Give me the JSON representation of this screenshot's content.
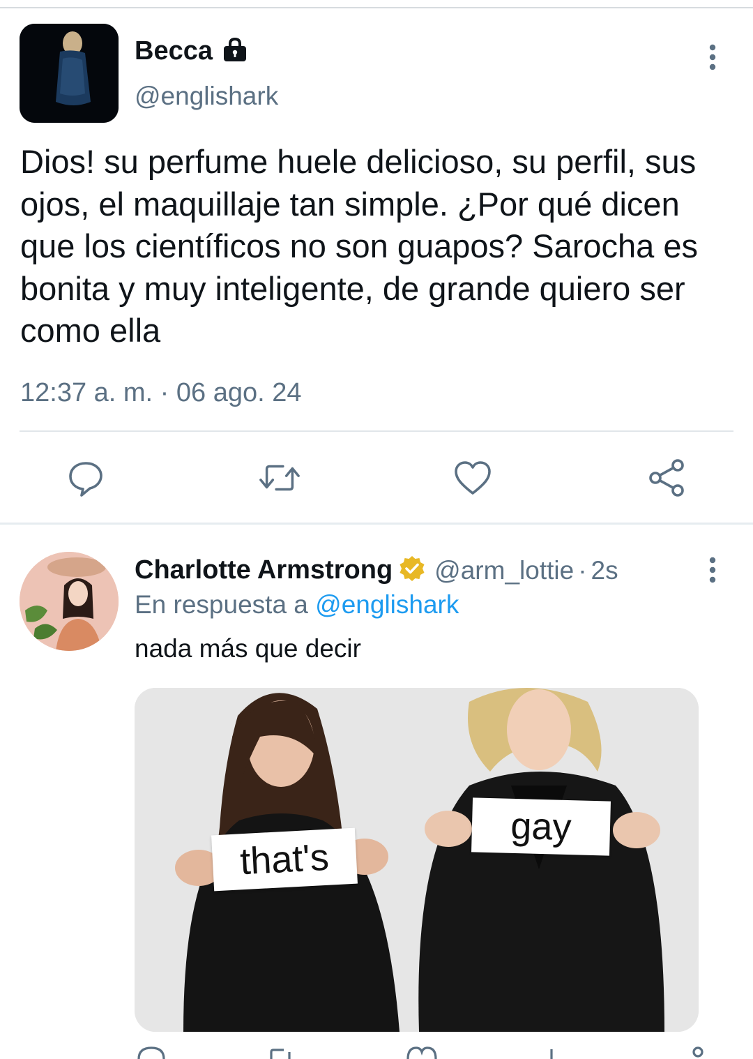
{
  "tweet": {
    "author_name": "Becca",
    "author_handle": "@englishark",
    "text": "Dios! su perfume huele delicioso, su perfil, sus ojos, el maquillaje tan simple. ¿Por qué dicen que los científicos no son guapos? Sarocha es bonita y muy inteligente, de grande quiero ser como ella",
    "timestamp": "12:37 a. m. · 06 ago. 24",
    "icons": {
      "protected": "lock-icon",
      "more": "more-vertical-icon",
      "reply": "reply-icon",
      "retweet": "retweet-icon",
      "like": "heart-icon",
      "share": "share-icon"
    }
  },
  "reply": {
    "author_name": "Charlotte Armstrong",
    "author_handle": "@arm_lottie",
    "separator": "·",
    "time": "2s",
    "in_reply_prefix": "En respuesta a",
    "in_reply_mention": "@englishark",
    "text": "nada más que decir",
    "media_captions": {
      "left": "that's",
      "right": "gay"
    },
    "icons": {
      "verified": "verified-badge-icon",
      "more": "more-vertical-icon"
    }
  },
  "colors": {
    "text_primary": "#0f1419",
    "text_secondary": "#5b7083",
    "link": "#1d9bf0",
    "verified": "#e8b825",
    "icon": "#5b7083"
  }
}
